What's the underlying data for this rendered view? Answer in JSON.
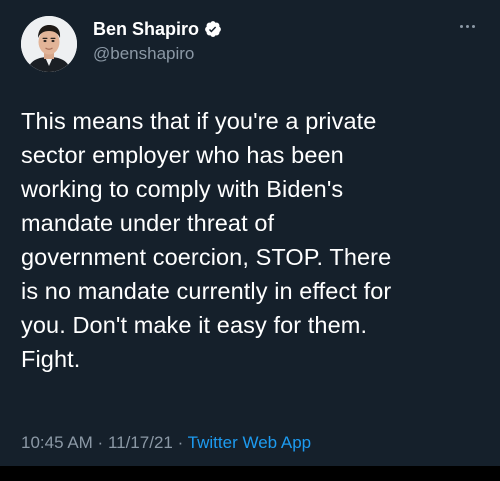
{
  "author": {
    "display_name": "Ben Shapiro",
    "handle": "@benshapiro",
    "verified_icon": "verified-badge-icon"
  },
  "menu": {
    "icon": "more-options-icon"
  },
  "tweet": {
    "text": "This means that if you're a private\nsector employer who has been\nworking to comply with Biden's\nmandate under threat of\ngovernment coercion, STOP. There\nis no mandate currently in effect for\nyou. Don't make it easy for them.\nFight."
  },
  "meta": {
    "time": "10:45 AM",
    "separator_1": " · ",
    "date": "11/17/21",
    "separator_2": " · ",
    "source": "Twitter Web App"
  },
  "colors": {
    "background": "#15202b",
    "text": "#ffffff",
    "secondary_text": "#8b98a5",
    "accent": "#1d9bf0"
  }
}
